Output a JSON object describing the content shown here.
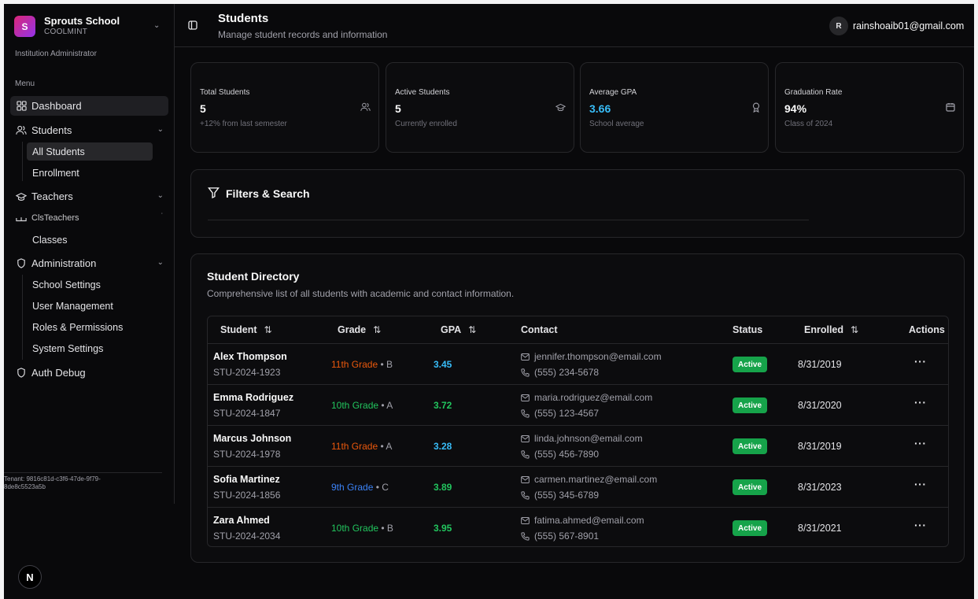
{
  "sidebar": {
    "org_name": "Sprouts School",
    "org_code": "COOLMINT",
    "org_initial": "S",
    "role": "Institution Administrator",
    "menu_label": "Menu",
    "items": [
      {
        "label": "Dashboard",
        "icon": "dashboard-icon"
      },
      {
        "label": "Students",
        "icon": "users-icon",
        "expanded": true
      },
      {
        "label": "Teachers",
        "icon": "graduation-cap-icon"
      },
      {
        "label": "ClsTeachers",
        "icon": "book-icon"
      },
      {
        "label": "Administration",
        "icon": "shield-icon",
        "expanded": true
      },
      {
        "label": "Auth Debug",
        "icon": "shield-icon"
      }
    ],
    "student_sub": [
      "All Students",
      "Enrollment"
    ],
    "teacher_sub": [
      "Classes"
    ],
    "admin_sub": [
      "School Settings",
      "User Management",
      "Roles & Permissions",
      "System Settings"
    ],
    "tenant": "Tenant: 9816c81d-c3f6-47de-9f79-8de8c5523a5b"
  },
  "header": {
    "title": "Students",
    "subtitle": "Manage student records and information",
    "avatar_initial": "R",
    "user_email": "rainshoaib01@gmail.com"
  },
  "stats": [
    {
      "title": "Total Students",
      "value": "5",
      "sub": "+12% from last semester",
      "icon": "users-icon"
    },
    {
      "title": "Active Students",
      "value": "5",
      "sub": "Currently enrolled",
      "icon": "graduation-cap-icon"
    },
    {
      "title": "Average GPA",
      "value": "3.66",
      "sub": "School average",
      "icon": "award-icon",
      "accent": "#38bdf8"
    },
    {
      "title": "Graduation Rate",
      "value": "94%",
      "sub": "Class of 2024",
      "icon": "calendar-icon"
    }
  ],
  "filters": {
    "title": "Filters & Search"
  },
  "directory": {
    "title": "Student Directory",
    "description": "Comprehensive list of all students with academic and contact information.",
    "columns": [
      "Student",
      "Grade",
      "GPA",
      "Contact",
      "Status",
      "Enrolled",
      "Actions"
    ],
    "rows": [
      {
        "name": "Alex Thompson",
        "id": "STU-2024-1923",
        "grade": "11th Grade",
        "grade_color": "#ea580c",
        "letter": "B",
        "gpa": "3.45",
        "gpa_color": "#38bdf8",
        "email": "jennifer.thompson@email.com",
        "phone": "(555) 234-5678",
        "status": "Active",
        "enrolled": "8/31/2019"
      },
      {
        "name": "Emma Rodriguez",
        "id": "STU-2024-1847",
        "grade": "10th Grade",
        "grade_color": "#22c55e",
        "letter": "A",
        "gpa": "3.72",
        "gpa_color": "#22c55e",
        "email": "maria.rodriguez@email.com",
        "phone": "(555) 123-4567",
        "status": "Active",
        "enrolled": "8/31/2020"
      },
      {
        "name": "Marcus Johnson",
        "id": "STU-2024-1978",
        "grade": "11th Grade",
        "grade_color": "#ea580c",
        "letter": "A",
        "gpa": "3.28",
        "gpa_color": "#38bdf8",
        "email": "linda.johnson@email.com",
        "phone": "(555) 456-7890",
        "status": "Active",
        "enrolled": "8/31/2019"
      },
      {
        "name": "Sofia Martinez",
        "id": "STU-2024-1856",
        "grade": "9th Grade",
        "grade_color": "#3b82f6",
        "letter": "C",
        "gpa": "3.89",
        "gpa_color": "#22c55e",
        "email": "carmen.martinez@email.com",
        "phone": "(555) 345-6789",
        "status": "Active",
        "enrolled": "8/31/2023"
      },
      {
        "name": "Zara Ahmed",
        "id": "STU-2024-2034",
        "grade": "10th Grade",
        "grade_color": "#22c55e",
        "letter": "B",
        "gpa": "3.95",
        "gpa_color": "#22c55e",
        "email": "fatima.ahmed@email.com",
        "phone": "(555) 567-8901",
        "status": "Active",
        "enrolled": "8/31/2021"
      }
    ],
    "actions_label": "···"
  },
  "dev_badge": "N",
  "colors": {
    "background": "#09090b",
    "card": "#0c0c0e",
    "border": "#27272a",
    "status_green": "#16a34a"
  }
}
